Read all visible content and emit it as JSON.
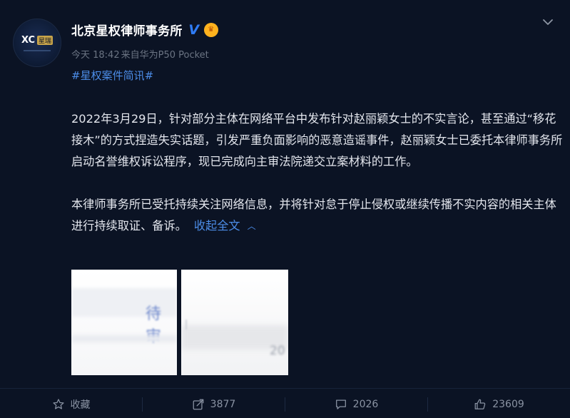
{
  "post": {
    "author": {
      "name": "北京星权律师事务所",
      "avatar_text": "XC",
      "avatar_tag": "星瑞",
      "verified_badge": "V"
    },
    "meta": {
      "time": "今天 18:42",
      "source": "来自华为P50 Pocket"
    },
    "tag": "#星权案件简讯#",
    "paragraphs": [
      "2022年3月29日，针对部分主体在网络平台中发布针对赵丽颖女士的不实言论，甚至通过“移花接木”的方式捏造失实话题，引发严重负面影响的恶意造谣事件，赵丽颖女士已委托本律师事务所启动名誉维权诉讼程序，现已完成向主审法院递交立案材料的工作。",
      "本律师事务所已受托持续关注网络信息，并将针对怠于停止侵权或继续传播不实内容的相关主体进行持续取证、备诉。"
    ],
    "collapse_label": "收起全文",
    "images": [
      {
        "visible_text": "待审"
      },
      {
        "visible_text": "20"
      }
    ]
  },
  "actions": {
    "favorite": {
      "label": "收藏",
      "icon": "star-icon"
    },
    "repost": {
      "count": "3877",
      "icon": "repost-icon"
    },
    "comment": {
      "count": "2026",
      "icon": "comment-icon"
    },
    "like": {
      "count": "23609",
      "icon": "thumbs-up-icon"
    }
  },
  "colors": {
    "background": "#0b1324",
    "link": "#4c8de8",
    "muted": "#6b7483",
    "verified": "#2f7cf6",
    "crown": "#ffb21e"
  }
}
